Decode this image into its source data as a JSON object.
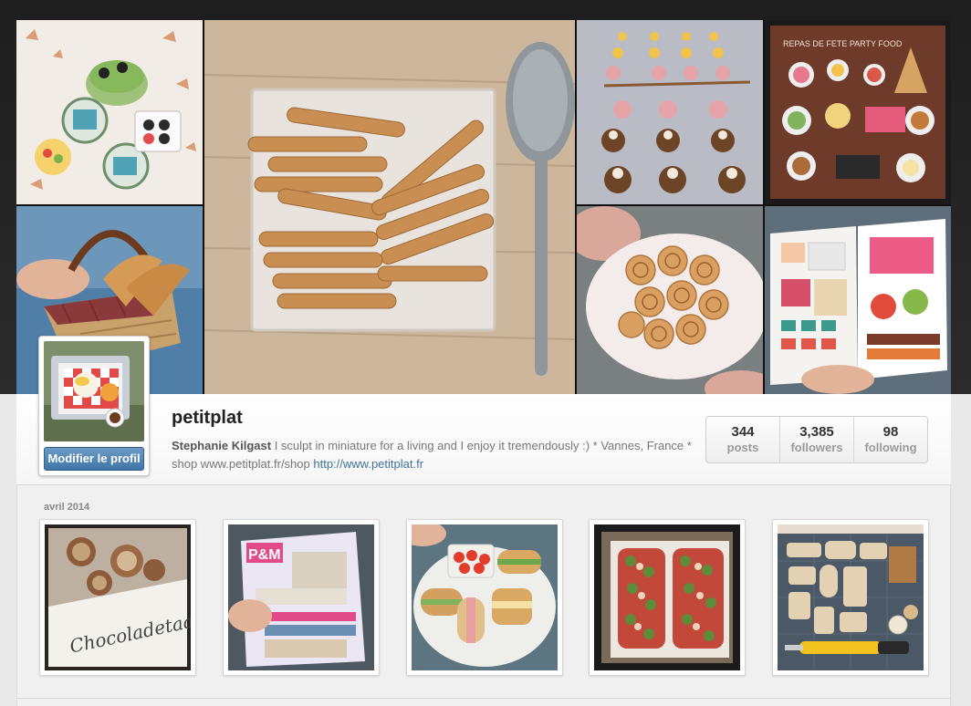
{
  "profile": {
    "username": "petitplat",
    "full_name": "Stephanie Kilgast",
    "bio_text": " I sculpt in miniature for a living and I enjoy it tremendously :) * Vannes, France * shop www.petitplat.fr/shop ",
    "website": "http://www.petitplat.fr",
    "edit_button_label": "Modifier le profil"
  },
  "stats": [
    {
      "value": "344",
      "label": "posts"
    },
    {
      "value": "3,385",
      "label": "followers"
    },
    {
      "value": "98",
      "label": "following"
    }
  ],
  "collage": {
    "tiles": [
      {
        "subject": "cake-on-plate"
      },
      {
        "subject": "bread-basket"
      },
      {
        "subject": "baguettes-on-tile"
      },
      {
        "subject": "cupcake-rows"
      },
      {
        "subject": "party-food-spread",
        "caption": "REPAS DE FETE  PARTY FOOD"
      },
      {
        "subject": "swirl-pastries"
      },
      {
        "subject": "open-magazine"
      }
    ]
  },
  "feed": {
    "month": "avril 2014",
    "photos": [
      {
        "subject": "chocolate-tart-photo",
        "caption": "Chocoladetaart"
      },
      {
        "subject": "magazine-cover-photo",
        "caption": "P&M"
      },
      {
        "subject": "sandwich-plate-photo"
      },
      {
        "subject": "pizza-photo"
      },
      {
        "subject": "cutting-board-photo"
      }
    ]
  }
}
